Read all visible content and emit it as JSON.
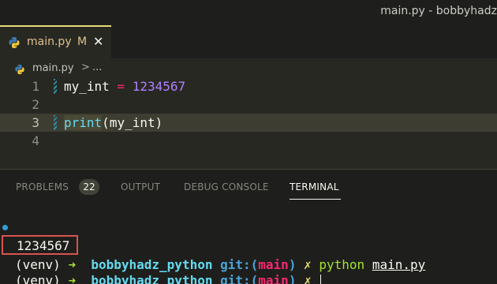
{
  "window": {
    "title": "main.py - bobbyhadz"
  },
  "tab": {
    "filename": "main.py",
    "badge": "M",
    "close": "✕"
  },
  "breadcrumb": {
    "file": "main.py",
    "separator": ">",
    "more": "..."
  },
  "editor": {
    "lines": [
      {
        "number": "1",
        "tokens": [
          "my_int",
          " = ",
          "1234567"
        ]
      },
      {
        "number": "2",
        "tokens": []
      },
      {
        "number": "3",
        "tokens": [
          "print",
          "(",
          "my_int",
          ")"
        ]
      },
      {
        "number": "4",
        "tokens": []
      }
    ]
  },
  "panel": {
    "tabs": {
      "problems": "PROBLEMS",
      "problems_count": "22",
      "output": "OUTPUT",
      "debug": "DEBUG CONSOLE",
      "terminal": "TERMINAL"
    }
  },
  "terminal": {
    "venv": "(venv)",
    "arrow": "➜",
    "dir": "bobbyhadz_python",
    "git_label": "git:(",
    "branch": "main",
    "git_close": ")",
    "dirty": "✗",
    "command": "python",
    "command_arg": "main.py",
    "output": "1234567"
  },
  "colors": {
    "accent": "#e6db74",
    "terminal_dir": "#66d9ef",
    "branch": "#f92672",
    "highlight_box": "#d9534f"
  }
}
